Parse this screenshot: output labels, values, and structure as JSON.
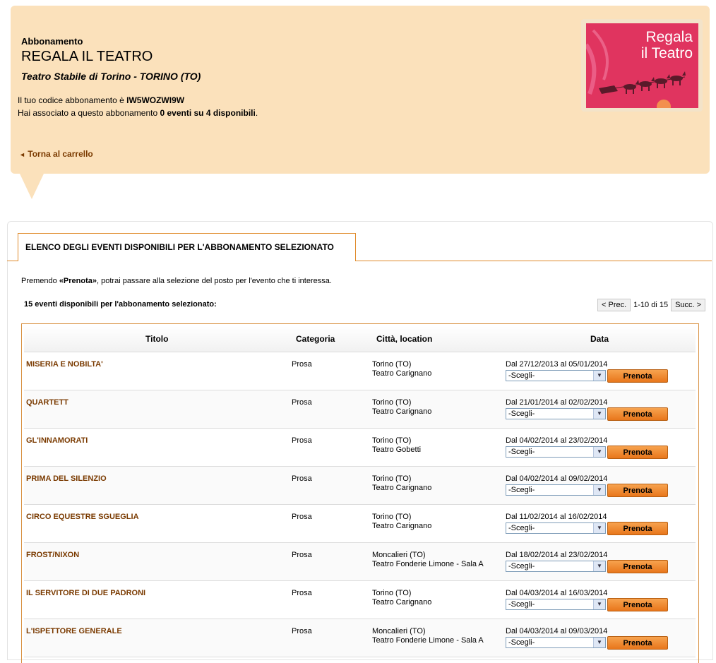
{
  "header": {
    "label": "Abbonamento",
    "title": "REGALA IL TEATRO",
    "venue": "Teatro Stabile di Torino - TORINO (TO)",
    "code_prefix": "Il tuo codice abbonamento è ",
    "code": "IW5WOZWI9W",
    "assoc_prefix": "Hai associato a questo abbonamento ",
    "assoc_value": "0 eventi su 4 disponibili",
    "assoc_suffix": ".",
    "back_link": "Torna al carrello",
    "back_icon": "◄",
    "promo_line1": "Regala",
    "promo_line2": "il Teatro"
  },
  "tab": {
    "label": "ELENCO DEGLI EVENTI DISPONIBILI PER L'ABBONAMENTO SELEZIONATO"
  },
  "intro": {
    "prefix": "Premendo ",
    "keyword": "«Prenota»",
    "suffix": ", potrai passare alla selezione del posto per l'evento che ti interessa."
  },
  "count_text": "15 eventi disponibili per l'abbonamento selezionato:",
  "pager": {
    "prev": "< Prec.",
    "info": "1-10 di 15",
    "next": "Succ. >"
  },
  "table": {
    "headers": {
      "title": "Titolo",
      "category": "Categoria",
      "location": "Città, location",
      "date": "Data"
    },
    "select_placeholder": "-Scegli-",
    "button_label": "Prenota",
    "rows": [
      {
        "title": "MISERIA E NOBILTA'",
        "category": "Prosa",
        "city": "Torino (TO)",
        "venue": "Teatro Carignano",
        "dates": "Dal 27/12/2013 al 05/01/2014"
      },
      {
        "title": "QUARTETT",
        "category": "Prosa",
        "city": "Torino (TO)",
        "venue": "Teatro Carignano",
        "dates": "Dal 21/01/2014 al 02/02/2014"
      },
      {
        "title": "GL'INNAMORATI",
        "category": "Prosa",
        "city": "Torino (TO)",
        "venue": "Teatro Gobetti",
        "dates": "Dal 04/02/2014 al 23/02/2014"
      },
      {
        "title": "PRIMA DEL SILENZIO",
        "category": "Prosa",
        "city": "Torino (TO)",
        "venue": "Teatro Carignano",
        "dates": "Dal 04/02/2014 al 09/02/2014"
      },
      {
        "title": "CIRCO EQUESTRE SGUEGLIA",
        "category": "Prosa",
        "city": "Torino (TO)",
        "venue": "Teatro Carignano",
        "dates": "Dal 11/02/2014 al 16/02/2014"
      },
      {
        "title": "FROST/NIXON",
        "category": "Prosa",
        "city": "Moncalieri (TO)",
        "venue": "Teatro Fonderie Limone - Sala A",
        "dates": "Dal 18/02/2014 al 23/02/2014"
      },
      {
        "title": "IL SERVITORE DI DUE PADRONI",
        "category": "Prosa",
        "city": "Torino (TO)",
        "venue": "Teatro Carignano",
        "dates": "Dal 04/03/2014 al 16/03/2014"
      },
      {
        "title": "L'ISPETTORE GENERALE",
        "category": "Prosa",
        "city": "Moncalieri (TO)",
        "venue": "Teatro Fonderie Limone - Sala A",
        "dates": "Dal 04/03/2014 al 09/03/2014"
      }
    ]
  },
  "colors": {
    "header_bg": "#fbe1bb",
    "link": "#7a3a00",
    "accent": "#e08a2a",
    "button": "#f08b2a",
    "promo": "#e0345f"
  }
}
